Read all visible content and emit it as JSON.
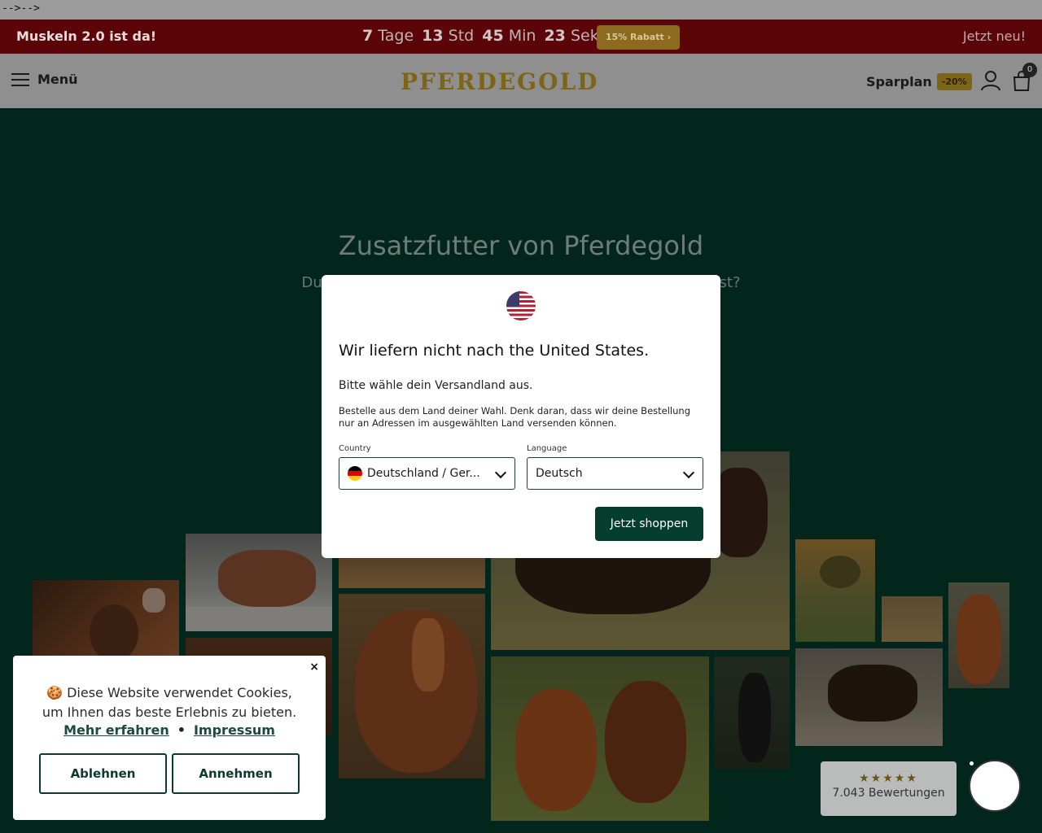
{
  "stray_text": "-->-->",
  "announcement": {
    "left": "Muskeln 2.0 ist da!",
    "countdown": [
      {
        "num": "7",
        "unit": "Tage"
      },
      {
        "num": "13",
        "unit": "Std"
      },
      {
        "num": "45",
        "unit": "Min"
      },
      {
        "num": "23",
        "unit": "Sek"
      }
    ],
    "promo": "15% Rabatt ›",
    "right": "Jetzt neu!"
  },
  "header": {
    "menu_label": "Menü",
    "logo": "PFERDEGOLD",
    "sparplan_label": "Sparplan",
    "sparplan_badge": "-20%",
    "cart_count": "0"
  },
  "hero": {
    "title": "Zusatzfutter von Pferdegold",
    "subtitle": "Du liebst dein Pferd und willst, dass es optimal versorgt ist?"
  },
  "modal": {
    "heading": "Wir liefern nicht nach the United States.",
    "text1": "Bitte wähle dein Versandland aus.",
    "text2": "Bestelle aus dem Land deiner Wahl. Denk daran, dass wir deine Bestellung nur an Adressen im ausgewählten Land versenden können.",
    "country_label": "Country",
    "country_value": "Deutschland / Ger...",
    "language_label": "Language",
    "language_value": "Deutsch",
    "button": "Jetzt shoppen"
  },
  "cookie": {
    "message": "🍪 Diese Website verwendet Cookies, um Ihnen das beste Erlebnis zu bieten.",
    "link_more": "Mehr erfahren",
    "link_imprint": "Impressum",
    "decline": "Ablehnen",
    "accept": "Annehmen",
    "close": "×"
  },
  "reviews": {
    "stars": "★★★★★",
    "count": "7.043 Bewertungen"
  }
}
